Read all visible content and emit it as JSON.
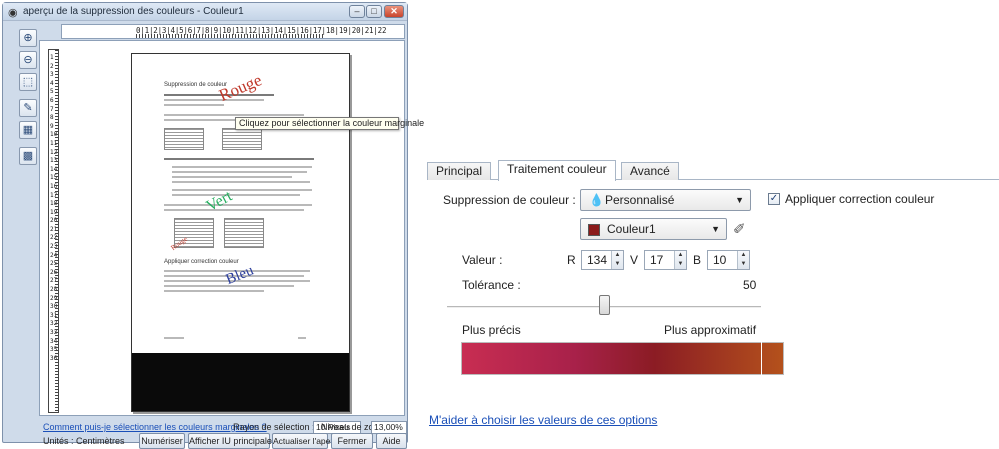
{
  "window": {
    "title": "aperçu de la suppression des couleurs - Couleur1",
    "minimize": "–",
    "maximize": "□",
    "close": "✕"
  },
  "ruler_top_label": "0|1|2|3|4|5|6|7|8|9|10|11|12|13|14|15|16|17|18|19|20|21|22",
  "ruler_left_label": "1 2 3 4 5 6 7 8 9 10 11 12 13 14 15 16 17 18 19 20 21 22 23 24 25 26 27 28 29 30 31 32 33 34 35 36",
  "page": {
    "heading": "Suppression de couleur",
    "section2": "Appliquer correction couleur",
    "watermarks": {
      "rouge": "Rouge",
      "vert": "Vert",
      "bleu": "Bleu",
      "small": "Rouge"
    }
  },
  "tooltip": "Cliquez pour sélectionner la couleur marginale",
  "bottom": {
    "help_link": "Comment puis-je sélectionner les couleurs marginales ?",
    "radius_label": "Rayon de sélection :",
    "radius_value": "10 Pixels",
    "zoom_label": "Niveau de zoom :",
    "zoom_value": "13,00%",
    "units": "Unités : Centimètres",
    "buttons": {
      "scan": "Numériser",
      "show_ui": "Afficher IU principale",
      "refresh": "Actualiser l'aperçu",
      "close": "Fermer",
      "help": "Aide"
    }
  },
  "panel": {
    "tabs": [
      "Principal",
      "Traitement couleur",
      "Avancé"
    ],
    "color_removal_label": "Suppression de couleur :",
    "color_removal_value": "Personnalisé",
    "color_value": "Couleur1",
    "value_label": "Valeur :",
    "r_label": "R",
    "r_value": "134",
    "v_label": "V",
    "v_value": "17",
    "b_label": "B",
    "b_value": "10",
    "tolerance_label": "Tolérance :",
    "tolerance_value": "50",
    "slider_fraction": 0.5,
    "precise_label": "Plus précis",
    "approx_label": "Plus approximatif",
    "apply_checkbox_label": "Appliquer correction couleur",
    "apply_checked": true,
    "help_link": "M'aider à choisir les valeurs de ces options"
  },
  "colors": {
    "swatch": "#8b1b1b",
    "link": "#1a4fb8"
  }
}
